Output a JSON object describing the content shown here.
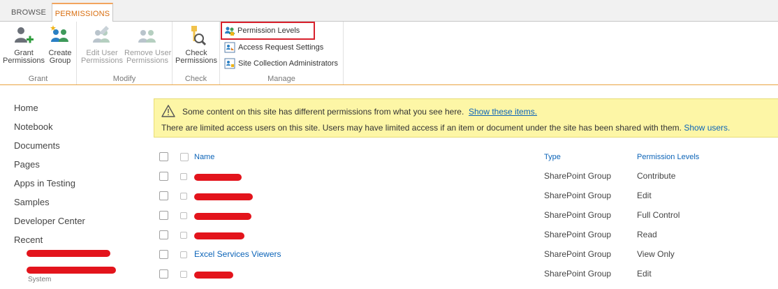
{
  "tabs": [
    {
      "label": "BROWSE",
      "active": false
    },
    {
      "label": "PERMISSIONS",
      "active": true
    }
  ],
  "ribbon": {
    "grant": {
      "label": "Grant",
      "buttons": [
        {
          "line1": "Grant",
          "line2": "Permissions",
          "icon": "grant-permissions-icon"
        },
        {
          "line1": "Create",
          "line2": "Group",
          "icon": "create-group-icon"
        }
      ]
    },
    "modify": {
      "label": "Modify",
      "buttons": [
        {
          "line1": "Edit User",
          "line2": "Permissions",
          "icon": "edit-user-permissions-icon",
          "disabled": true
        },
        {
          "line1": "Remove User",
          "line2": "Permissions",
          "icon": "remove-user-permissions-icon",
          "disabled": true
        }
      ]
    },
    "check": {
      "label": "Check",
      "buttons": [
        {
          "line1": "Check",
          "line2": "Permissions",
          "icon": "check-permissions-icon"
        }
      ]
    },
    "manage": {
      "label": "Manage",
      "buttons": [
        {
          "label": "Permission Levels",
          "icon": "permission-levels-icon",
          "highlighted": true
        },
        {
          "label": "Access Request Settings",
          "icon": "access-request-icon"
        },
        {
          "label": "Site Collection Administrators",
          "icon": "site-admins-icon"
        }
      ]
    }
  },
  "leftnav": {
    "items": [
      "Home",
      "Notebook",
      "Documents",
      "Pages",
      "Apps in Testing",
      "Samples",
      "Developer Center",
      "Recent"
    ],
    "partial_text": "System"
  },
  "banner": {
    "line1": "Some content on this site has different permissions from what you see here.",
    "line1_link": "Show these items.",
    "line2": "There are limited access users on this site. Users may have limited access if an item or document under the site has been shared with them.",
    "line2_link": "Show users."
  },
  "table": {
    "headers": {
      "name": "Name",
      "type": "Type",
      "perm": "Permission Levels"
    },
    "rows": [
      {
        "name": "",
        "redacted": true,
        "type": "SharePoint Group",
        "perm": "Contribute"
      },
      {
        "name": "",
        "redacted": true,
        "type": "SharePoint Group",
        "perm": "Edit"
      },
      {
        "name": "",
        "redacted": true,
        "type": "SharePoint Group",
        "perm": "Full Control"
      },
      {
        "name": "",
        "redacted": true,
        "type": "SharePoint Group",
        "perm": "Read"
      },
      {
        "name": "Excel Services Viewers",
        "redacted": false,
        "type": "SharePoint Group",
        "perm": "View Only"
      },
      {
        "name": "",
        "redacted": true,
        "type": "SharePoint Group",
        "perm": "Edit"
      }
    ]
  },
  "colors": {
    "accent": "#d86c0c",
    "ribbon_border": "#e9a341",
    "link": "#0c64b8",
    "highlight_box": "#d8202c",
    "banner_bg": "#fdf6a6",
    "redaction": "#e3141c"
  }
}
